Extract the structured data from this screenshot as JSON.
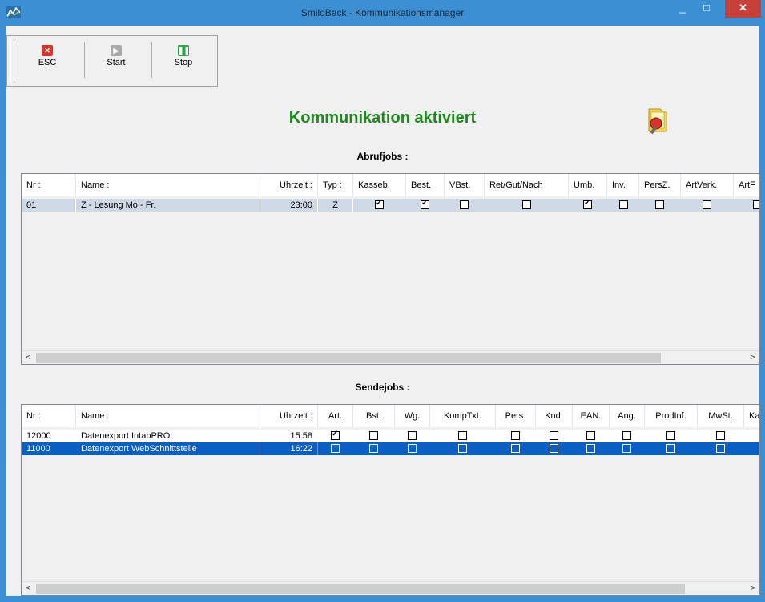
{
  "window": {
    "title": "SmiloBack - Kommunikationsmanager",
    "minimize": "_",
    "maximize": "□",
    "close": "✕"
  },
  "toolbar": {
    "esc_label": "ESC",
    "start_label": "Start",
    "stop_label": "Stop"
  },
  "status_heading": "Kommunikation aktiviert",
  "abrufjobs": {
    "title": "Abrufjobs :",
    "columns": [
      "Nr :",
      "Name :",
      "Uhrzeit :",
      "Typ :",
      "Kasseb.",
      "Best.",
      "VBst.",
      "Ret/Gut/Nach",
      "Umb.",
      "Inv.",
      "PersZ.",
      "ArtVerk.",
      "ArtF"
    ],
    "rows": [
      {
        "nr": "01",
        "name": "Z - Lesung Mo - Fr.",
        "uhrzeit": "23:00",
        "typ": "Z",
        "checks": [
          true,
          true,
          false,
          false,
          true,
          false,
          false,
          false,
          false
        ]
      }
    ],
    "scroll_left": "<",
    "scroll_right": ">"
  },
  "sendejobs": {
    "title": "Sendejobs :",
    "columns": [
      "Nr :",
      "Name :",
      "Uhrzeit :",
      "Art.",
      "Bst.",
      "Wg.",
      "KompTxt.",
      "Pers.",
      "Knd.",
      "EAN.",
      "Ang.",
      "ProdInf.",
      "MwSt.",
      "Ka"
    ],
    "rows": [
      {
        "nr": "12000",
        "name": "Datenexport IntabPRO",
        "uhrzeit": "15:58",
        "checks": [
          true,
          false,
          false,
          false,
          false,
          false,
          false,
          false,
          false,
          false
        ]
      },
      {
        "nr": "11000",
        "name": "Datenexport WebSchnittstelle",
        "uhrzeit": "16:22",
        "checks": [
          false,
          false,
          false,
          false,
          false,
          false,
          false,
          false,
          false,
          false
        ]
      }
    ],
    "scroll_left": "<",
    "scroll_right": ">"
  },
  "colors": {
    "titlebar": "#3c8fd3",
    "close_button": "#c7413a",
    "heading_green": "#1a8a1a",
    "selection": "#0a5fc4",
    "row_highlight": "#cfd9e6",
    "esc_icon": "#d9342b",
    "start_icon": "#a9a9a9",
    "stop_icon": "#2aa346"
  },
  "icons": {
    "app": "smiloback-logo-icon",
    "folder": "folder-key-icon"
  }
}
